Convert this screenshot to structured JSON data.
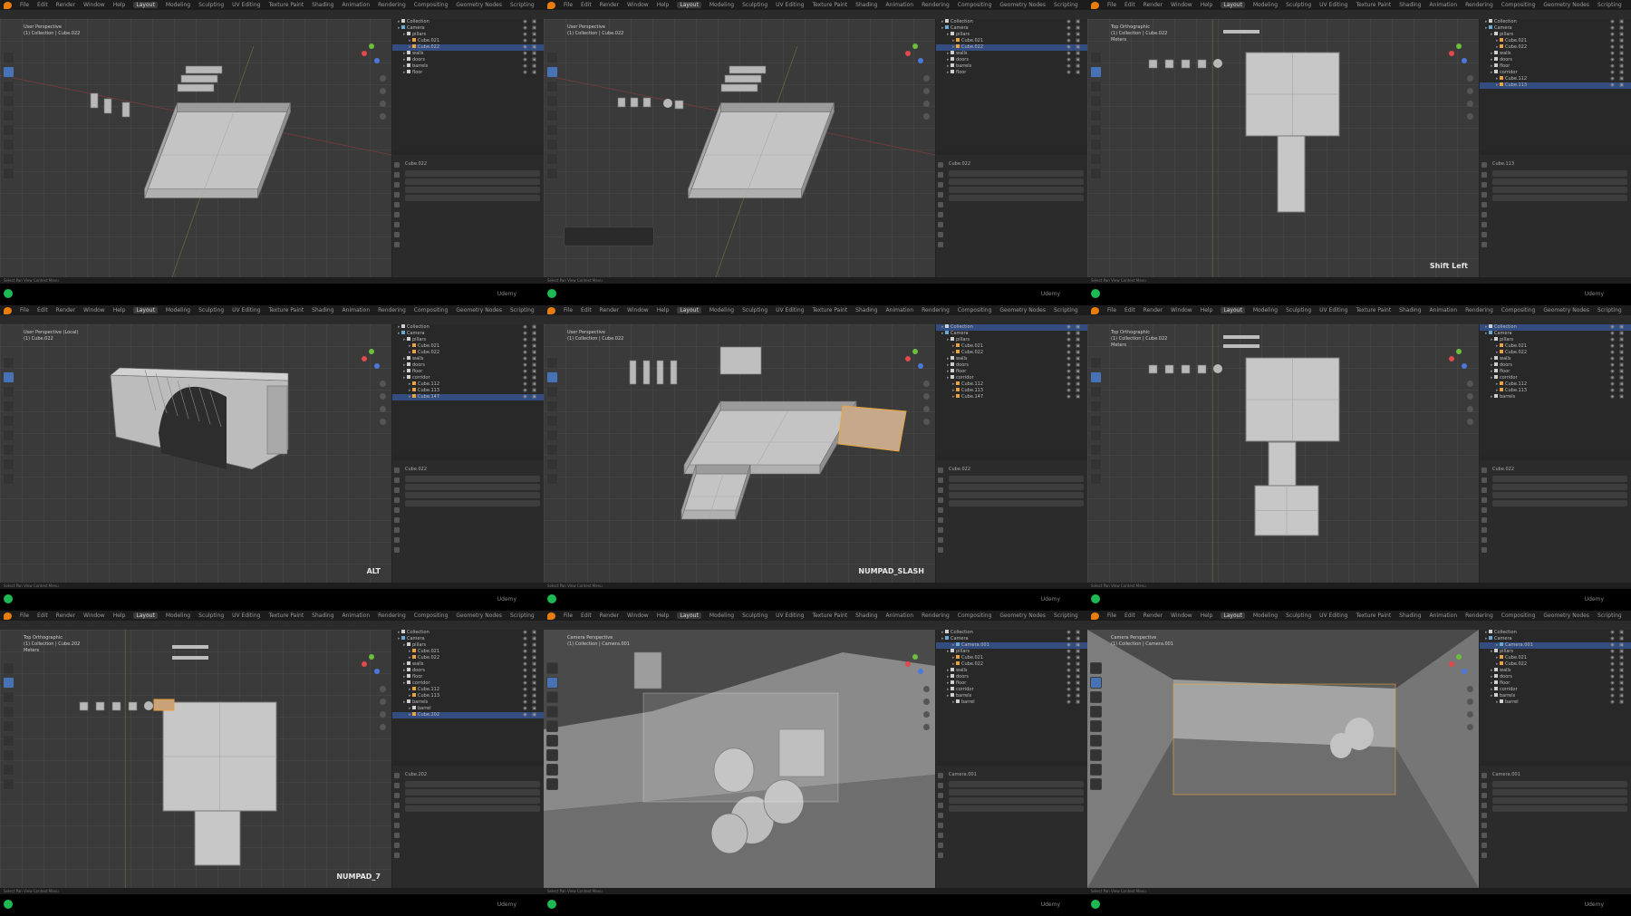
{
  "menus": [
    "File",
    "Edit",
    "Render",
    "Window",
    "Help"
  ],
  "workspace_tabs": [
    "Layout",
    "Modeling",
    "Sculpting",
    "UV Editing",
    "Texture Paint",
    "Shading",
    "Animation",
    "Rendering",
    "Compositing",
    "Geometry Nodes",
    "Scripting"
  ],
  "active_workspace": "Layout",
  "taskbar_label": "Udemy",
  "colors": {
    "accent": "#4772b3",
    "selection_orange": "#e8a33d",
    "mesh_grey": "#bdbdbd",
    "blender_orange": "#e87d0d",
    "taskbar_green": "#1db954"
  },
  "frames": [
    {
      "viewport_info": [
        "User Perspective",
        "(1) Collection | Cube.022"
      ],
      "key_overlay": "",
      "outliner": [
        "Collection",
        "Camera",
        "pillars",
        "Cube.021",
        "Cube.022",
        "walls",
        "doors",
        "barrels",
        "floor"
      ],
      "selected_row": 4,
      "props_title": "Cube.022",
      "status": "Select  Pan View  Context Menu"
    },
    {
      "viewport_info": [
        "User Perspective",
        "(1) Collection | Cube.022"
      ],
      "key_overlay": "",
      "outliner": [
        "Collection",
        "Camera",
        "pillars",
        "Cube.021",
        "Cube.022",
        "walls",
        "doors",
        "barrels",
        "floor"
      ],
      "selected_row": 4,
      "props_title": "Cube.022",
      "status": "Select  Pan View  Context Menu"
    },
    {
      "viewport_info": [
        "Top Orthographic",
        "(1) Collection | Cube.022",
        "Meters"
      ],
      "key_overlay": "Shift Left",
      "outliner": [
        "Collection",
        "Camera",
        "pillars",
        "Cube.021",
        "Cube.022",
        "walls",
        "doors",
        "floor",
        "corridor",
        "Cube.112",
        "Cube.113"
      ],
      "selected_row": 10,
      "props_title": "Cube.113",
      "status": "Select  Pan View  Context Menu"
    },
    {
      "viewport_info": [
        "User Perspective (Local)",
        "(1) Cube.022"
      ],
      "key_overlay": "ALT",
      "outliner": [
        "Collection",
        "Camera",
        "pillars",
        "Cube.021",
        "Cube.022",
        "walls",
        "doors",
        "floor",
        "corridor",
        "Cube.112",
        "Cube.113",
        "Cube.147"
      ],
      "selected_row": 11,
      "props_title": "Cube.022",
      "status": "Select  Pan View  Context Menu"
    },
    {
      "viewport_info": [
        "User Perspective",
        "(1) Collection | Cube.022"
      ],
      "key_overlay": "NUMPAD_SLASH",
      "outliner": [
        "Collection",
        "Camera",
        "pillars",
        "Cube.021",
        "Cube.022",
        "walls",
        "doors",
        "floor",
        "corridor",
        "Cube.112",
        "Cube.113",
        "Cube.147"
      ],
      "selected_row": 0,
      "props_title": "Cube.022",
      "status": "Select  Pan View  Context Menu"
    },
    {
      "viewport_info": [
        "Top Orthographic",
        "(1) Collection | Cube.022",
        "Meters"
      ],
      "key_overlay": "",
      "outliner": [
        "Collection",
        "Camera",
        "pillars",
        "Cube.021",
        "Cube.022",
        "walls",
        "doors",
        "floor",
        "corridor",
        "Cube.112",
        "Cube.113",
        "barrels"
      ],
      "selected_row": 0,
      "props_title": "Cube.022",
      "status": "Select  Pan View  Context Menu"
    },
    {
      "viewport_info": [
        "Top Orthographic",
        "(1) Collection | Cube.202",
        "Meters"
      ],
      "key_overlay": "NUMPAD_7",
      "outliner": [
        "Collection",
        "Camera",
        "pillars",
        "Cube.021",
        "Cube.022",
        "walls",
        "doors",
        "floor",
        "corridor",
        "Cube.112",
        "Cube.113",
        "barrels",
        "barrel",
        "Cube.202"
      ],
      "selected_row": 13,
      "props_title": "Cube.202",
      "status": "Select  Pan View  Context Menu"
    },
    {
      "viewport_info": [
        "Camera Perspective",
        "(1) Collection | Camera.001"
      ],
      "key_overlay": "",
      "outliner": [
        "Collection",
        "Camera",
        "Camera.001",
        "pillars",
        "Cube.021",
        "Cube.022",
        "walls",
        "doors",
        "floor",
        "corridor",
        "barrels",
        "barrel"
      ],
      "selected_row": 2,
      "props_title": "Camera.001",
      "status": "Select  Pan View  Context Menu"
    },
    {
      "viewport_info": [
        "Camera Perspective",
        "(1) Collection | Camera.001"
      ],
      "key_overlay": "",
      "outliner": [
        "Collection",
        "Camera",
        "Camera.001",
        "pillars",
        "Cube.021",
        "Cube.022",
        "walls",
        "doors",
        "floor",
        "corridor",
        "barrels",
        "barrel"
      ],
      "selected_row": 2,
      "props_title": "Camera.001",
      "status": "Select  Pan View  Context Menu"
    }
  ]
}
